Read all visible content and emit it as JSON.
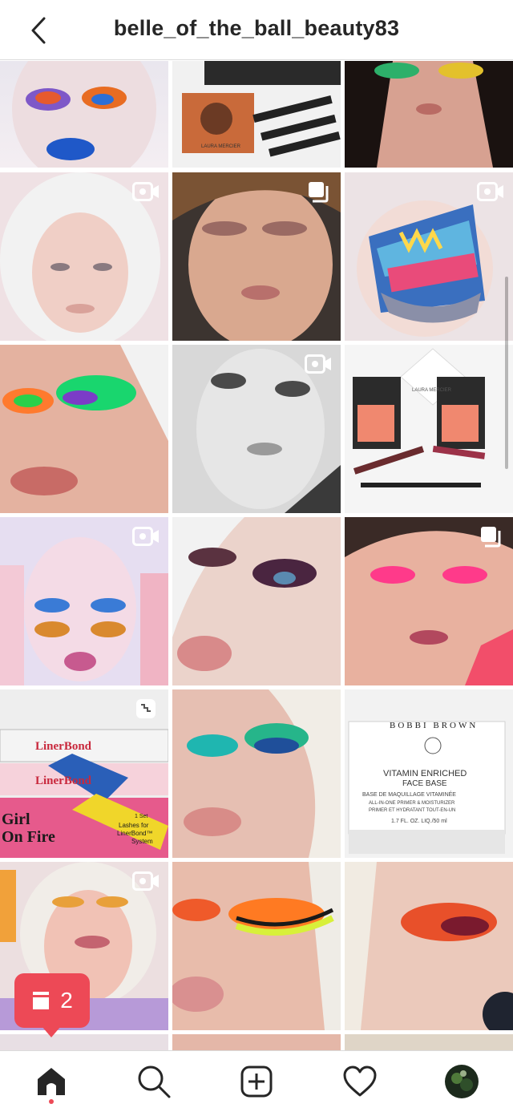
{
  "header": {
    "username": "belle_of_the_ball_beauty83",
    "back_icon": "chevron-left-icon"
  },
  "grid": {
    "tiles": [
      {
        "kind": "photo",
        "desc": "face-blue-lips",
        "badge": ""
      },
      {
        "kind": "photo",
        "desc": "laura-mercier-product",
        "badge": "",
        "texts": [
          "LAURA MERCIER"
        ]
      },
      {
        "kind": "photo",
        "desc": "rainbow-eyes-face",
        "badge": ""
      },
      {
        "kind": "video",
        "desc": "filter-face-white-hair",
        "badge": "video-icon"
      },
      {
        "kind": "carousel",
        "desc": "bronze-eyes-face",
        "badge": "carousel-icon"
      },
      {
        "kind": "video",
        "desc": "tattoo-emtor",
        "badge": "video-icon"
      },
      {
        "kind": "photo",
        "desc": "green-rainbow-eyes",
        "badge": ""
      },
      {
        "kind": "video",
        "desc": "bw-face",
        "badge": "video-icon"
      },
      {
        "kind": "photo",
        "desc": "laura-mercier-blush-set",
        "badge": "",
        "texts": [
          "LAURA MERCIER"
        ]
      },
      {
        "kind": "video",
        "desc": "filter-face-orange-blue",
        "badge": "video-icon"
      },
      {
        "kind": "photo",
        "desc": "smoky-plum-eyes",
        "badge": ""
      },
      {
        "kind": "carousel",
        "desc": "pink-eyes-face",
        "badge": "carousel-icon"
      },
      {
        "kind": "reel",
        "desc": "linerbond-boxes",
        "badge": "reel-icon",
        "texts": [
          "LinerBond",
          "LinerBond",
          "Girl",
          "On Fire",
          "1 Set",
          "Lashes for",
          "LinerBond™",
          "System"
        ]
      },
      {
        "kind": "photo",
        "desc": "teal-lashes-face",
        "badge": ""
      },
      {
        "kind": "photo",
        "desc": "bobbi-brown-box",
        "badge": "",
        "texts": [
          "BOBBI BROWN",
          "VITAMIN ENRICHED",
          "FACE BASE",
          "BASE DE MAQUILLAGE VITAMINÉE",
          "ALL-IN-ONE PRIMER & MOISTURIZER",
          "PRIMER ET HYDRATANT TOUT-EN-UN",
          "1.7 FL. OZ. LIQ./50 ml"
        ]
      },
      {
        "kind": "video",
        "desc": "smiling-face",
        "badge": "video-icon"
      },
      {
        "kind": "photo",
        "desc": "neon-liner-eyes",
        "badge": ""
      },
      {
        "kind": "photo",
        "desc": "orange-sunset-eyes",
        "badge": ""
      }
    ]
  },
  "notification": {
    "count": "2",
    "icon": "posts-stack-icon"
  },
  "bottom_nav": {
    "items": [
      "home-icon",
      "search-icon",
      "new-post-icon",
      "activity-heart-icon",
      "profile-avatar-icon"
    ]
  },
  "colors": {
    "accent_red": "#ed4956",
    "divider": "#dbdbdb",
    "text": "#262626"
  }
}
